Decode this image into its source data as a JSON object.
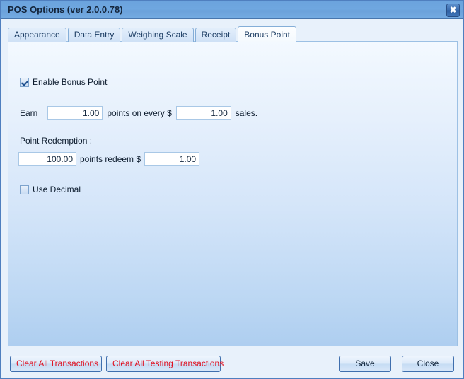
{
  "window": {
    "title": "POS Options (ver 2.0.0.78)",
    "close_icon": "close-icon",
    "close_glyph": "✖",
    "accent_color": "#6ba3dd",
    "danger_color": "#e01020"
  },
  "tabs": [
    {
      "label": "Appearance",
      "active": false
    },
    {
      "label": "Data Entry",
      "active": false
    },
    {
      "label": "Weighing Scale",
      "active": false
    },
    {
      "label": "Receipt",
      "active": false
    },
    {
      "label": "Bonus Point",
      "active": true
    }
  ],
  "panel": {
    "enable_bonus_point": {
      "label": "Enable Bonus Point",
      "checked": true
    },
    "earn_row": {
      "prefix_label": "Earn",
      "points_value": "1.00",
      "middle_label": "points on every $",
      "amount_value": "1.00",
      "suffix_label": "sales."
    },
    "redemption": {
      "title": "Point Redemption :",
      "points_value": "100.00",
      "middle_label": "points redeem $",
      "amount_value": "1.00"
    },
    "use_decimal": {
      "label": "Use Decimal",
      "checked": false
    }
  },
  "footer": {
    "clear_all_transactions": "Clear All Transactions",
    "clear_all_testing_transactions": "Clear All Testing Transactions",
    "save": "Save",
    "close": "Close"
  }
}
